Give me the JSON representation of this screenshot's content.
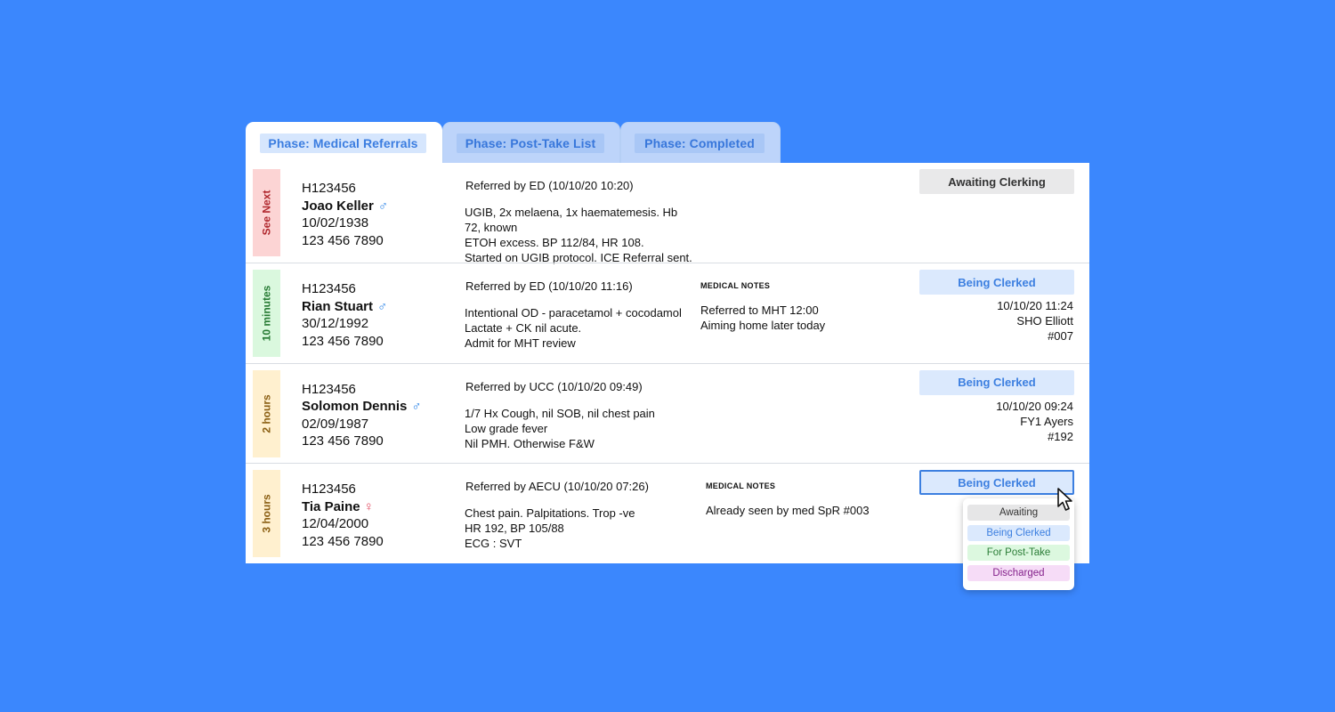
{
  "tabs": [
    {
      "label": "Phase: Medical Referrals",
      "active": true
    },
    {
      "label": "Phase: Post-Take List",
      "active": false
    },
    {
      "label": "Phase: Completed",
      "active": false
    }
  ],
  "rows": [
    {
      "urgency": "See Next",
      "urgency_color": "red",
      "hospital_no": "H123456",
      "name": "Joao Keller",
      "gender": "♂",
      "dob": "10/02/1938",
      "phone": "123 456 7890",
      "referred_by": "Referred by ED (10/10/20 10:20)",
      "referral_lines": [
        "UGIB, 2x melaena, 1x haematemesis. Hb 72, known",
        "ETOH excess. BP 112/84, HR 108.",
        "Started on UGIB protocol. ICE Referral sent."
      ],
      "notes_header": "",
      "notes_lines": [],
      "status": "Awaiting Clerking",
      "status_style": "gray",
      "meta": [
        "",
        "",
        ""
      ]
    },
    {
      "urgency": "10 minutes",
      "urgency_color": "green",
      "hospital_no": "H123456",
      "name": "Rian Stuart",
      "gender": "♂",
      "dob": "30/12/1992",
      "phone": "123 456 7890",
      "referred_by": "Referred by ED (10/10/20 11:16)",
      "referral_lines": [
        "Intentional OD - paracetamol + cocodamol",
        "Lactate + CK nil acute.",
        "Admit for MHT review"
      ],
      "notes_header": "MEDICAL NOTES",
      "notes_lines": [
        "Referred to MHT 12:00",
        "Aiming home later today"
      ],
      "status": "Being Clerked",
      "status_style": "blue",
      "meta": [
        "10/10/20 11:24",
        "SHO Elliott",
        "#007"
      ]
    },
    {
      "urgency": "2 hours",
      "urgency_color": "amber",
      "hospital_no": "H123456",
      "name": "Solomon Dennis",
      "gender": "♂",
      "dob": "02/09/1987",
      "phone": "123 456 7890",
      "referred_by": "Referred by UCC (10/10/20 09:49)",
      "referral_lines": [
        "1/7 Hx Cough, nil SOB, nil chest pain",
        "Low grade fever",
        "Nil PMH. Otherwise  F&W"
      ],
      "notes_header": "",
      "notes_lines": [],
      "status": "Being Clerked",
      "status_style": "blue",
      "meta": [
        "10/10/20 09:24",
        "FY1 Ayers",
        "#192"
      ]
    },
    {
      "urgency": "3 hours",
      "urgency_color": "amber",
      "hospital_no": "H123456",
      "name": "Tia Paine",
      "gender": "♀",
      "dob": "12/04/2000",
      "phone": "123 456 7890",
      "referred_by": "Referred by AECU (10/10/20 07:26)",
      "referral_lines": [
        "Chest pain. Palpitations. Trop -ve",
        "HR 192, BP 105/88",
        "ECG : SVT"
      ],
      "notes_header": "MEDICAL NOTES",
      "notes_lines": [
        "Already seen by med SpR #003"
      ],
      "status": "Being Clerked",
      "status_style": "blue-focused",
      "meta": [
        "",
        "",
        ""
      ]
    }
  ],
  "status_dropdown": {
    "options": [
      "Awaiting",
      "Being Clerked",
      "For Post-Take",
      "Discharged"
    ]
  },
  "colors": {
    "background": "#3b87fd",
    "accent": "#3c7fe0",
    "urgent_red": "#fcd4d4",
    "soon_green": "#daf8de",
    "later_amber": "#fff0cf"
  }
}
